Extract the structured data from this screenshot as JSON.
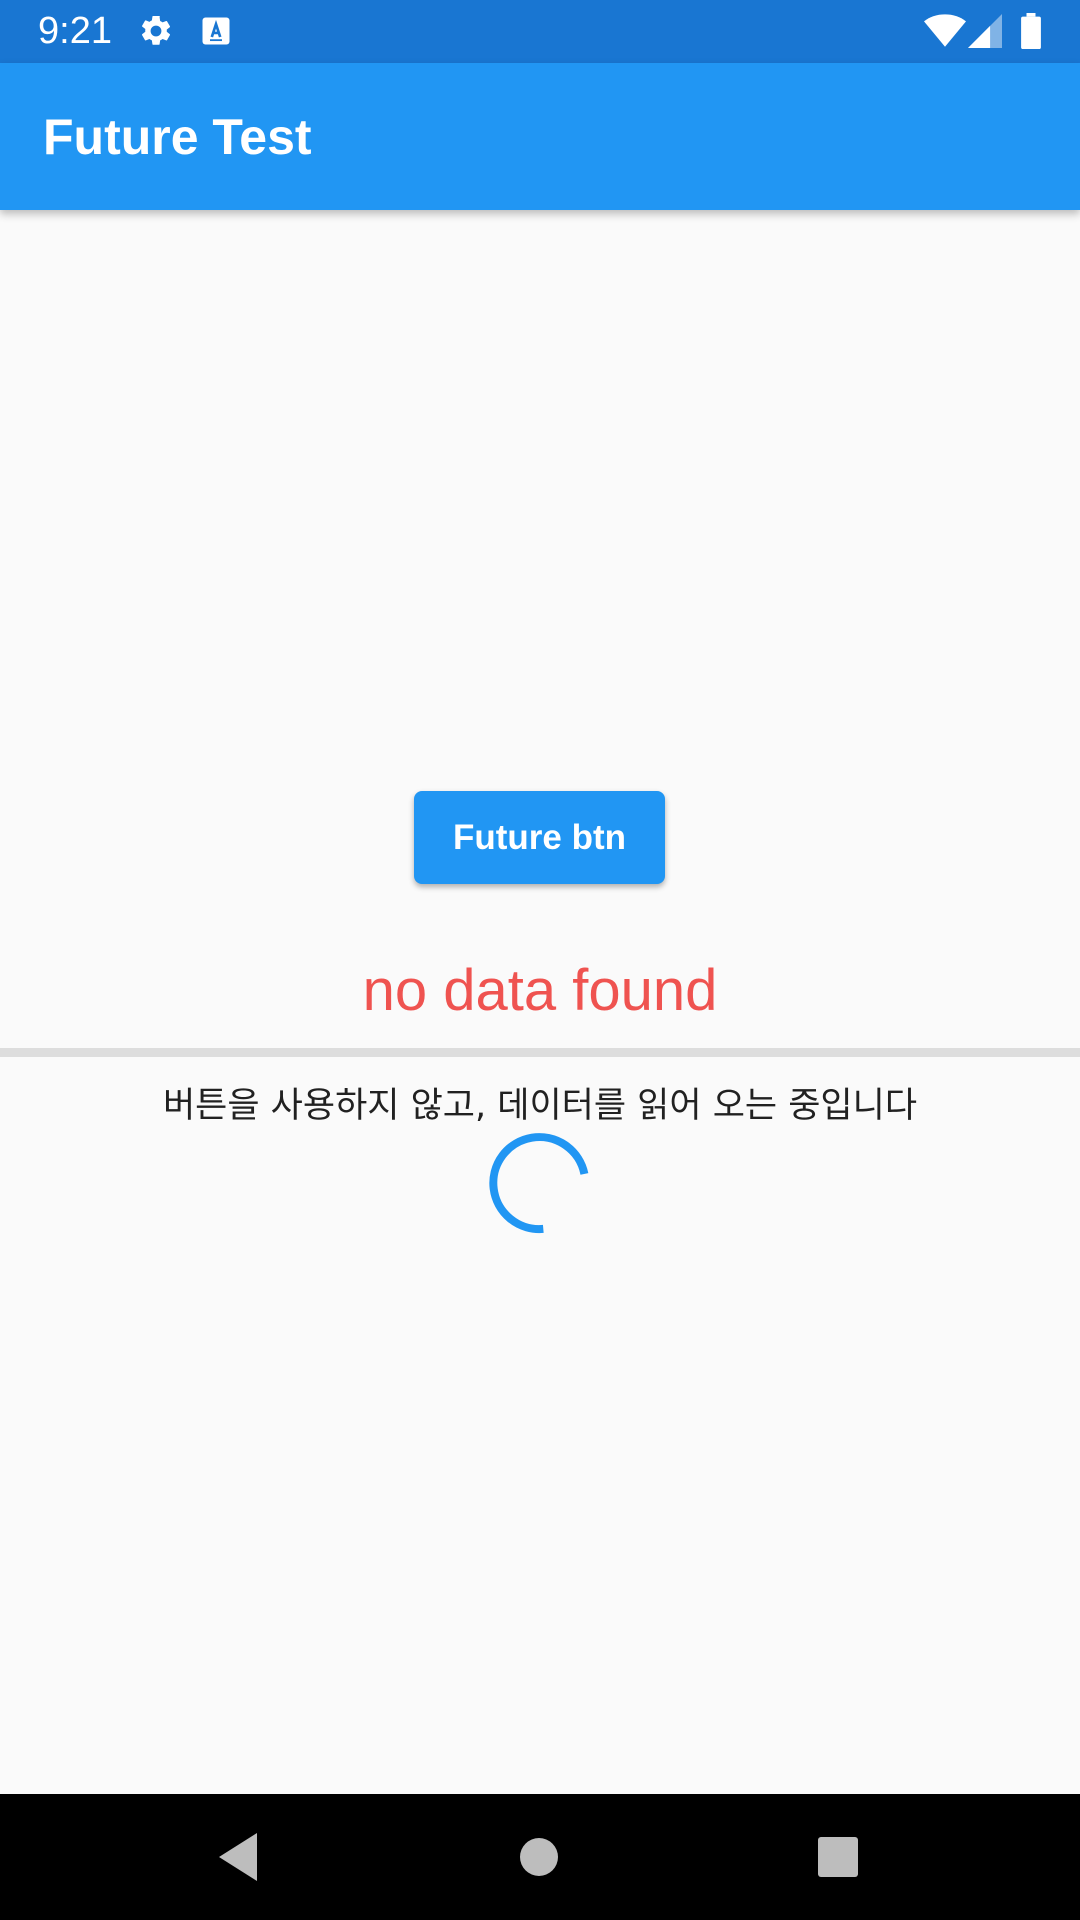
{
  "status_bar": {
    "time": "9:21",
    "icons": [
      "gear-icon",
      "font-a-icon",
      "wifi-icon",
      "signal-icon",
      "battery-icon"
    ]
  },
  "app_bar": {
    "title": "Future Test",
    "color": "#2196f3"
  },
  "main": {
    "button_label": "Future btn",
    "no_data_text": "no data found",
    "no_data_color": "#ef5350",
    "loading_text": "버튼을 사용하지 않고, 데이터를 읽어 오는 중입니다"
  },
  "nav_bar": {
    "icons": [
      "back-icon",
      "home-icon",
      "recents-icon"
    ]
  }
}
